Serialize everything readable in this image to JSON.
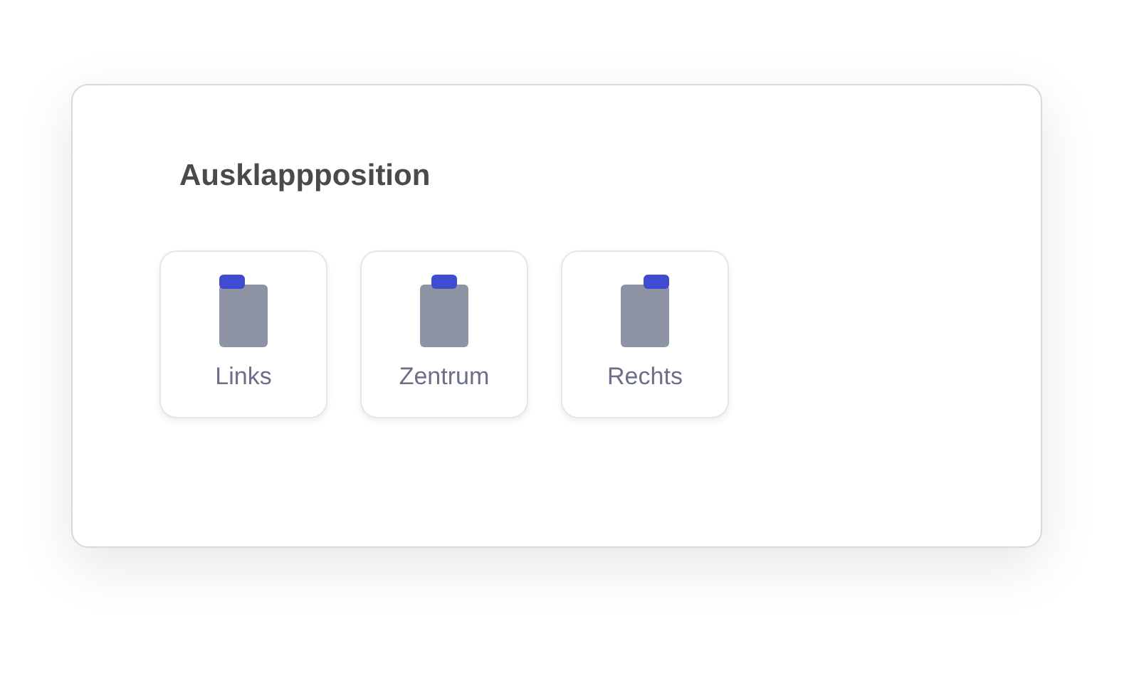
{
  "title": "Ausklappposition",
  "options": [
    {
      "label": "Links",
      "kind": "left"
    },
    {
      "label": "Zentrum",
      "kind": "center"
    },
    {
      "label": "Rechts",
      "kind": "right"
    }
  ]
}
